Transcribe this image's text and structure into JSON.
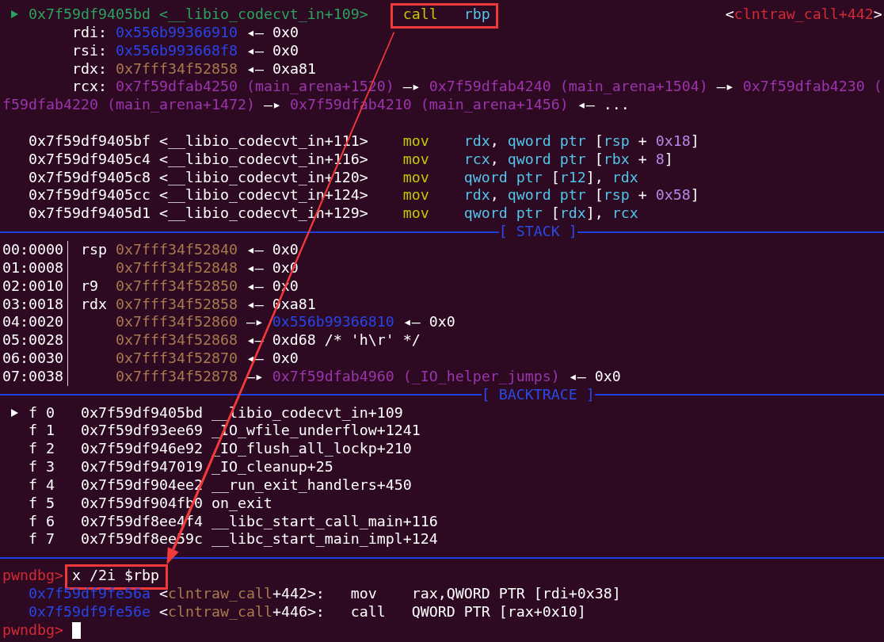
{
  "disassembly": [
    {
      "current": true,
      "address": "0x7f59df9405bd",
      "symbol": "<__libio_codecvt_in+109>",
      "mnemonic": "call",
      "operands": [
        {
          "text": "rbp",
          "kind": "reg"
        }
      ],
      "highlighted": true,
      "target": [
        {
          "text": "<",
          "kind": "plain"
        },
        {
          "text": "clntraw_call+442",
          "kind": "code"
        },
        {
          "text": ">",
          "kind": "plain"
        }
      ],
      "arguments": [
        {
          "kind": "register",
          "parts": [
            {
              "text": "rdi:",
              "kind": "register"
            },
            {
              "text": "0x556b99366910",
              "kind": "heap"
            },
            {
              "text": "◂—",
              "kind": "arrow"
            },
            {
              "text": "0x0",
              "kind": "value"
            }
          ]
        },
        {
          "kind": "register",
          "parts": [
            {
              "text": "rsi:",
              "kind": "register"
            },
            {
              "text": "0x556b993668f8",
              "kind": "heap"
            },
            {
              "text": "◂—",
              "kind": "arrow"
            },
            {
              "text": "0x0",
              "kind": "value"
            }
          ]
        },
        {
          "kind": "register",
          "parts": [
            {
              "text": "rdx:",
              "kind": "register"
            },
            {
              "text": "0x7fff34f52858",
              "kind": "stack"
            },
            {
              "text": "◂—",
              "kind": "arrow"
            },
            {
              "text": "0xa81",
              "kind": "value"
            }
          ]
        },
        {
          "kind": "register",
          "parts": [
            {
              "text": "rcx:",
              "kind": "register"
            },
            {
              "text": "0x7f59dfab4250 (main_arena+1520)",
              "kind": "data"
            },
            {
              "text": "—▸",
              "kind": "arrow"
            },
            {
              "text": "0x7f59dfab4240 (main_arena+1504)",
              "kind": "data"
            },
            {
              "text": "—▸",
              "kind": "arrow"
            },
            {
              "text": "0x7f59dfab4230 (",
              "kind": "data"
            }
          ]
        },
        {
          "kind": "wrap",
          "parts": [
            {
              "text": "f59dfab4220 (main_arena+1472)",
              "kind": "data"
            },
            {
              "text": "—▸",
              "kind": "arrow"
            },
            {
              "text": "0x7f59dfab4210 (main_arena+1456)",
              "kind": "data"
            },
            {
              "text": "◂—",
              "kind": "arrow"
            },
            {
              "text": "...",
              "kind": "value"
            }
          ]
        }
      ]
    },
    {
      "current": false,
      "address": "0x7f59df9405bf",
      "symbol": "<__libio_codecvt_in+111>",
      "mnemonic": "mov",
      "operands": [
        {
          "text": "rdx",
          "kind": "reg"
        },
        {
          "text": ", ",
          "kind": "punct"
        },
        {
          "text": "qword ptr",
          "kind": "reg"
        },
        {
          "text": " [",
          "kind": "punct"
        },
        {
          "text": "rsp",
          "kind": "reg"
        },
        {
          "text": " + ",
          "kind": "punct"
        },
        {
          "text": "0x18",
          "kind": "imm"
        },
        {
          "text": "]",
          "kind": "punct"
        }
      ],
      "highlighted": false
    },
    {
      "current": false,
      "address": "0x7f59df9405c4",
      "symbol": "<__libio_codecvt_in+116>",
      "mnemonic": "mov",
      "operands": [
        {
          "text": "rcx",
          "kind": "reg"
        },
        {
          "text": ", ",
          "kind": "punct"
        },
        {
          "text": "qword ptr",
          "kind": "reg"
        },
        {
          "text": " [",
          "kind": "punct"
        },
        {
          "text": "rbx",
          "kind": "reg"
        },
        {
          "text": " + ",
          "kind": "punct"
        },
        {
          "text": "8",
          "kind": "imm"
        },
        {
          "text": "]",
          "kind": "punct"
        }
      ],
      "highlighted": false
    },
    {
      "current": false,
      "address": "0x7f59df9405c8",
      "symbol": "<__libio_codecvt_in+120>",
      "mnemonic": "mov",
      "operands": [
        {
          "text": "qword ptr",
          "kind": "reg"
        },
        {
          "text": " [",
          "kind": "punct"
        },
        {
          "text": "r12",
          "kind": "reg"
        },
        {
          "text": "], ",
          "kind": "punct"
        },
        {
          "text": "rdx",
          "kind": "reg"
        }
      ],
      "highlighted": false
    },
    {
      "current": false,
      "address": "0x7f59df9405cc",
      "symbol": "<__libio_codecvt_in+124>",
      "mnemonic": "mov",
      "operands": [
        {
          "text": "rdx",
          "kind": "reg"
        },
        {
          "text": ", ",
          "kind": "punct"
        },
        {
          "text": "qword ptr",
          "kind": "reg"
        },
        {
          "text": " [",
          "kind": "punct"
        },
        {
          "text": "rsp",
          "kind": "reg"
        },
        {
          "text": " + ",
          "kind": "punct"
        },
        {
          "text": "0x58",
          "kind": "imm"
        },
        {
          "text": "]",
          "kind": "punct"
        }
      ],
      "highlighted": false
    },
    {
      "current": false,
      "address": "0x7f59df9405d1",
      "symbol": "<__libio_codecvt_in+129>",
      "mnemonic": "mov",
      "operands": [
        {
          "text": "qword ptr",
          "kind": "reg"
        },
        {
          "text": " [",
          "kind": "punct"
        },
        {
          "text": "rdx",
          "kind": "reg"
        },
        {
          "text": "], ",
          "kind": "punct"
        },
        {
          "text": "rcx",
          "kind": "reg"
        }
      ],
      "highlighted": false
    }
  ],
  "stack": {
    "title": "[ STACK ]",
    "rows": [
      {
        "offset": "00:0000",
        "register": "rsp",
        "parts": [
          {
            "text": "0x7fff34f52840",
            "kind": "stack"
          },
          {
            "text": "◂—",
            "kind": "arrow"
          },
          {
            "text": "0x0",
            "kind": "value"
          }
        ]
      },
      {
        "offset": "01:0008",
        "parts": [
          {
            "text": "0x7fff34f52848",
            "kind": "stack"
          },
          {
            "text": "◂—",
            "kind": "arrow"
          },
          {
            "text": "0x0",
            "kind": "value"
          }
        ]
      },
      {
        "offset": "02:0010",
        "register": "r9",
        "parts": [
          {
            "text": "0x7fff34f52850",
            "kind": "stack"
          },
          {
            "text": "◂—",
            "kind": "arrow"
          },
          {
            "text": "0x0",
            "kind": "value"
          }
        ]
      },
      {
        "offset": "03:0018",
        "register": "rdx",
        "parts": [
          {
            "text": "0x7fff34f52858",
            "kind": "stack"
          },
          {
            "text": "◂—",
            "kind": "arrow"
          },
          {
            "text": "0xa81",
            "kind": "value"
          }
        ]
      },
      {
        "offset": "04:0020",
        "parts": [
          {
            "text": "0x7fff34f52860",
            "kind": "stack"
          },
          {
            "text": "—▸",
            "kind": "arrow"
          },
          {
            "text": "0x556b99366810",
            "kind": "heap"
          },
          {
            "text": "◂—",
            "kind": "arrow"
          },
          {
            "text": "0x0",
            "kind": "value"
          }
        ]
      },
      {
        "offset": "05:0028",
        "parts": [
          {
            "text": "0x7fff34f52868",
            "kind": "stack"
          },
          {
            "text": "◂—",
            "kind": "arrow"
          },
          {
            "text": "0xd68 /* 'h\\r' */",
            "kind": "value"
          }
        ]
      },
      {
        "offset": "06:0030",
        "parts": [
          {
            "text": "0x7fff34f52870",
            "kind": "stack"
          },
          {
            "text": "◂—",
            "kind": "arrow"
          },
          {
            "text": "0x0",
            "kind": "value"
          }
        ]
      },
      {
        "offset": "07:0038",
        "parts": [
          {
            "text": "0x7fff34f52878",
            "kind": "stack"
          },
          {
            "text": "—▸",
            "kind": "arrow"
          },
          {
            "text": "0x7f59dfab4960 (_IO_helper_jumps)",
            "kind": "data"
          },
          {
            "text": "◂—",
            "kind": "arrow"
          },
          {
            "text": "0x0",
            "kind": "value"
          }
        ]
      }
    ]
  },
  "backtrace": {
    "title": "[ BACKTRACE ]",
    "frames": [
      {
        "selected": true,
        "frame": "f 0",
        "address": "0x7f59df9405bd",
        "function": "__libio_codecvt_in+109"
      },
      {
        "selected": false,
        "frame": "f 1",
        "address": "0x7f59df93ee69",
        "function": "_IO_wfile_underflow+1241"
      },
      {
        "selected": false,
        "frame": "f 2",
        "address": "0x7f59df946e92",
        "function": "_IO_flush_all_lockp+210"
      },
      {
        "selected": false,
        "frame": "f 3",
        "address": "0x7f59df947019",
        "function": "_IO_cleanup+25"
      },
      {
        "selected": false,
        "frame": "f 4",
        "address": "0x7f59df904ee2",
        "function": "__run_exit_handlers+450"
      },
      {
        "selected": false,
        "frame": "f 5",
        "address": "0x7f59df904fb0",
        "function": "on_exit"
      },
      {
        "selected": false,
        "frame": "f 6",
        "address": "0x7f59df8ee4f4",
        "function": "__libc_start_call_main+116"
      },
      {
        "selected": false,
        "frame": "f 7",
        "address": "0x7f59df8ee59c",
        "function": "__libc_start_main_impl+124"
      }
    ]
  },
  "console": [
    {
      "kind": "prompt",
      "prompt": "pwndbg>",
      "command": "x /2i $rbp",
      "highlighted": true,
      "cursor": false
    },
    {
      "kind": "output",
      "address": "0x7f59df9fe56a",
      "symbol": [
        {
          "text": "<",
          "kind": "plain"
        },
        {
          "text": "clntraw_call",
          "kind": "function"
        },
        {
          "text": "+442>:",
          "kind": "plain"
        }
      ],
      "mnemonic": "mov",
      "operands": "rax,QWORD PTR [rdi+0x38]"
    },
    {
      "kind": "output",
      "address": "0x7f59df9fe56e",
      "symbol": [
        {
          "text": "<",
          "kind": "plain"
        },
        {
          "text": "clntraw_call",
          "kind": "function"
        },
        {
          "text": "+446>:",
          "kind": "plain"
        }
      ],
      "mnemonic": "call",
      "operands": "QWORD PTR [rax+0x10]"
    },
    {
      "kind": "prompt",
      "prompt": "pwndbg>",
      "cursor": true
    }
  ],
  "annotation": {
    "arrow": true
  }
}
